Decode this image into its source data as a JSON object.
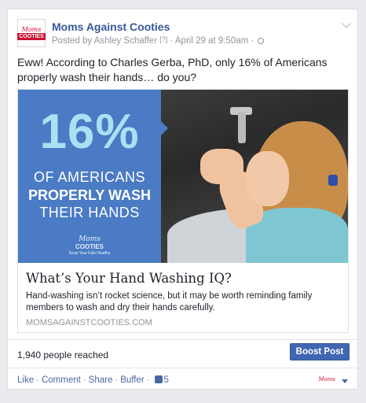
{
  "post": {
    "page_name": "Moms Against Cooties",
    "avatar_text_top": "Moms",
    "avatar_text_bottom": "COOTIES",
    "posted_by": "Posted by Ashley Schaffer",
    "posted_by_marker": "[?]",
    "date": "April 29 at 9:50am",
    "separator": "·",
    "text": "Eww! According to Charles Gerba, PhD, only 16% of Americans properly wash their hands… do you?"
  },
  "preview": {
    "image": {
      "percent": "16%",
      "line1": "OF AMERICANS",
      "line2": "PROPERLY WASH",
      "line3": "THEIR HANDS",
      "logo_top": "Moms",
      "logo_main": "COOTIES",
      "logo_tag": "Keep Your Kids Healthy"
    },
    "title": "What’s Your Hand Washing IQ?",
    "description": "Hand-washing isn’t rocket science, but it may be worth reminding family members to wash and dry their hands carefully.",
    "domain": "MOMSAGAINSTCOOTIES.COM"
  },
  "reach": {
    "text": "1,940 people reached",
    "boost_label": "Boost Post"
  },
  "actions": {
    "like": "Like",
    "comment": "Comment",
    "share": "Share",
    "buffer": "Buffer",
    "dot": "·",
    "like_count": "5",
    "mini_logo": "Moms"
  },
  "colors": {
    "link_blue": "#365899",
    "boost_blue": "#4267b2",
    "graphic_blue": "#4a7bc4",
    "graphic_cyan": "#a9e2f3",
    "brand_red": "#c8102e"
  }
}
